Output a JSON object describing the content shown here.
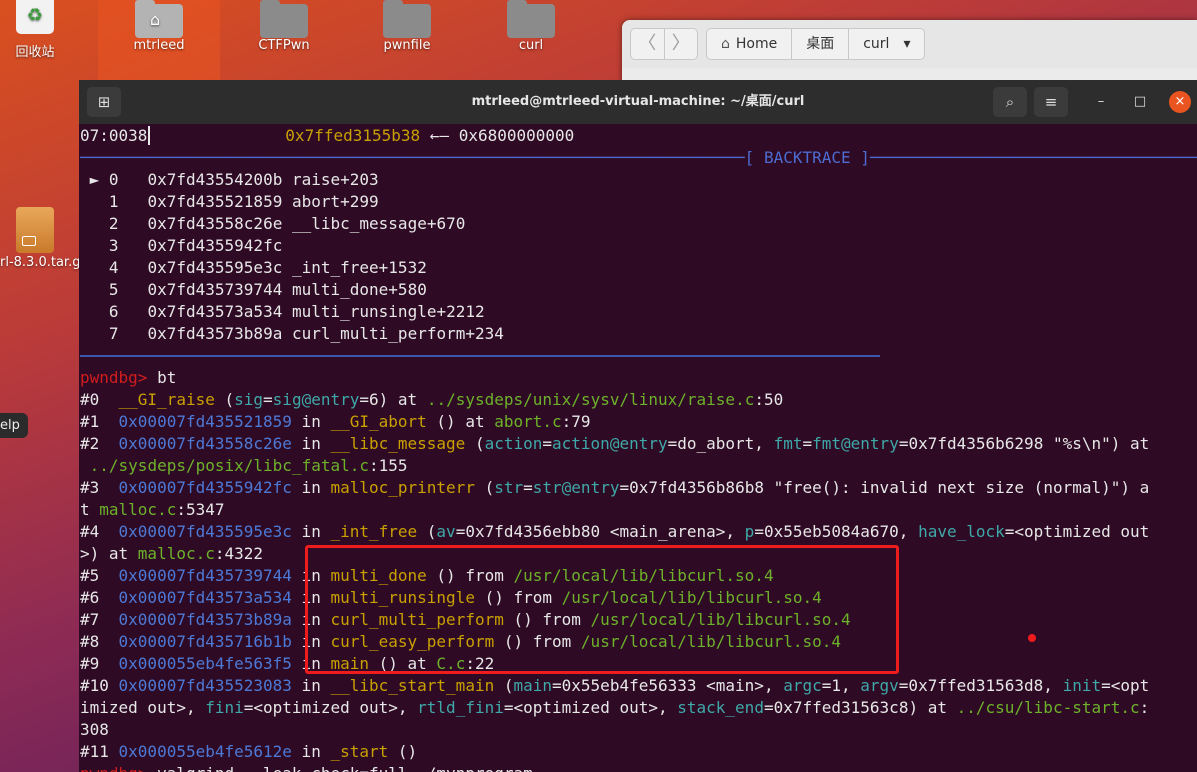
{
  "desktop": {
    "icons": [
      {
        "label": "回收站",
        "name": "trash"
      },
      {
        "label": "mtrleed",
        "name": "home-folder"
      },
      {
        "label": "CTFPwn",
        "name": "ctfpwn-folder"
      },
      {
        "label": "pwnfile",
        "name": "pwnfile-folder"
      },
      {
        "label": "curl",
        "name": "curl-folder"
      }
    ],
    "archive_label": "rl-8.3.0.tar.g",
    "help_tip": "elp"
  },
  "file_manager": {
    "nav_back": "〈",
    "nav_forward": "〉",
    "breadcrumbs": [
      "Home",
      "桌面",
      "curl"
    ],
    "dropdown_icon": "▾"
  },
  "terminal": {
    "title": "mtrleed@mtrleed-virtual-machine: ~/桌面/curl",
    "buttons": {
      "new_tab": "⊞",
      "search": "⌕",
      "menu": "≡",
      "minimize": "–",
      "maximize": "□",
      "close": "×"
    },
    "stack_line": {
      "offset": "07:0038",
      "addr": "0x7ffed3155b38",
      "arrow": " ←— ",
      "value": "0x6800000000"
    },
    "backtrace_header": "[ BACKTRACE ]",
    "backtrace_rule_left": "─────────────────────────────────────────────────────────────────────",
    "backtrace_rule_right": "─────────────────────────────────────────────────────────────",
    "frames": [
      {
        "marker": "►",
        "idx": "0",
        "addr": "0x7fd43554200b",
        "sym": "raise+203"
      },
      {
        "marker": " ",
        "idx": "1",
        "addr": "0x7fd435521859",
        "sym": "abort+299"
      },
      {
        "marker": " ",
        "idx": "2",
        "addr": "0x7fd43558c26e",
        "sym": "__libc_message+670"
      },
      {
        "marker": " ",
        "idx": "3",
        "addr": "0x7fd4355942fc",
        "sym": ""
      },
      {
        "marker": " ",
        "idx": "4",
        "addr": "0x7fd435595e3c",
        "sym": "_int_free+1532"
      },
      {
        "marker": " ",
        "idx": "5",
        "addr": "0x7fd435739744",
        "sym": "multi_done+580"
      },
      {
        "marker": " ",
        "idx": "6",
        "addr": "0x7fd43573a534",
        "sym": "multi_runsingle+2212"
      },
      {
        "marker": " ",
        "idx": "7",
        "addr": "0x7fd43573b89a",
        "sym": "curl_multi_perform+234"
      }
    ],
    "prompt": "pwndbg>",
    "command": " bt",
    "bt_lines": [
      [
        [
          "#0  ",
          "w"
        ],
        [
          "__GI_raise",
          "y"
        ],
        [
          " (",
          "w"
        ],
        [
          "sig",
          "t"
        ],
        [
          "=",
          "w"
        ],
        [
          "sig@entry",
          "t"
        ],
        [
          "=6) at ",
          "w"
        ],
        [
          "../sysdeps/unix/sysv/linux/raise.c",
          "g"
        ],
        [
          ":50",
          "w"
        ]
      ],
      [
        [
          "#1  ",
          "w"
        ],
        [
          "0x00007fd435521859",
          "b"
        ],
        [
          " in ",
          "w"
        ],
        [
          "__GI_abort",
          "y"
        ],
        [
          " () at ",
          "w"
        ],
        [
          "abort.c",
          "g"
        ],
        [
          ":79",
          "w"
        ]
      ],
      [
        [
          "#2  ",
          "w"
        ],
        [
          "0x00007fd43558c26e",
          "b"
        ],
        [
          " in ",
          "w"
        ],
        [
          "__libc_message",
          "y"
        ],
        [
          " (",
          "w"
        ],
        [
          "action",
          "t"
        ],
        [
          "=",
          "w"
        ],
        [
          "action@entry",
          "t"
        ],
        [
          "=do_abort, ",
          "w"
        ],
        [
          "fmt",
          "t"
        ],
        [
          "=",
          "w"
        ],
        [
          "fmt@entry",
          "t"
        ],
        [
          "=0x7fd4356b6298 \"%s\\n\") at",
          "w"
        ]
      ],
      [
        [
          " ",
          "w"
        ],
        [
          "../sysdeps/posix/libc_fatal.c",
          "g"
        ],
        [
          ":155",
          "w"
        ]
      ],
      [
        [
          "#3  ",
          "w"
        ],
        [
          "0x00007fd4355942fc",
          "b"
        ],
        [
          " in ",
          "w"
        ],
        [
          "malloc_printerr",
          "y"
        ],
        [
          " (",
          "w"
        ],
        [
          "str",
          "t"
        ],
        [
          "=",
          "w"
        ],
        [
          "str@entry",
          "t"
        ],
        [
          "=0x7fd4356b86b8 \"free(): invalid next size (normal)\") a",
          "w"
        ]
      ],
      [
        [
          "t ",
          "w"
        ],
        [
          "malloc.c",
          "g"
        ],
        [
          ":5347",
          "w"
        ]
      ],
      [
        [
          "#4  ",
          "w"
        ],
        [
          "0x00007fd435595e3c",
          "b"
        ],
        [
          " in ",
          "w"
        ],
        [
          "_int_free",
          "y"
        ],
        [
          " (",
          "w"
        ],
        [
          "av",
          "t"
        ],
        [
          "=0x7fd4356ebb80 <main_arena>, ",
          "w"
        ],
        [
          "p",
          "t"
        ],
        [
          "=0x55eb5084a670, ",
          "w"
        ],
        [
          "have_lock",
          "t"
        ],
        [
          "=<optimized out",
          "w"
        ]
      ],
      [
        [
          ">) at ",
          "w"
        ],
        [
          "malloc.c",
          "g"
        ],
        [
          ":4322",
          "w"
        ]
      ],
      [
        [
          "#5  ",
          "w"
        ],
        [
          "0x00007fd435739744",
          "b"
        ],
        [
          " in ",
          "w"
        ],
        [
          "multi_done",
          "y"
        ],
        [
          " () from ",
          "w"
        ],
        [
          "/usr/local/lib/libcurl.so.4",
          "g"
        ]
      ],
      [
        [
          "#6  ",
          "w"
        ],
        [
          "0x00007fd43573a534",
          "b"
        ],
        [
          " in ",
          "w"
        ],
        [
          "multi_runsingle",
          "y"
        ],
        [
          " () from ",
          "w"
        ],
        [
          "/usr/local/lib/libcurl.so.4",
          "g"
        ]
      ],
      [
        [
          "#7  ",
          "w"
        ],
        [
          "0x00007fd43573b89a",
          "b"
        ],
        [
          " in ",
          "w"
        ],
        [
          "curl_multi_perform",
          "y"
        ],
        [
          " () from ",
          "w"
        ],
        [
          "/usr/local/lib/libcurl.so.4",
          "g"
        ]
      ],
      [
        [
          "#8  ",
          "w"
        ],
        [
          "0x00007fd435716b1b",
          "b"
        ],
        [
          " in ",
          "w"
        ],
        [
          "curl_easy_perform",
          "y"
        ],
        [
          " () from ",
          "w"
        ],
        [
          "/usr/local/lib/libcurl.so.4",
          "g"
        ]
      ],
      [
        [
          "#9  ",
          "w"
        ],
        [
          "0x000055eb4fe563f5",
          "b"
        ],
        [
          " in ",
          "w"
        ],
        [
          "main",
          "y"
        ],
        [
          " () at ",
          "w"
        ],
        [
          "C.c",
          "g"
        ],
        [
          ":22",
          "w"
        ]
      ],
      [
        [
          "#10 ",
          "w"
        ],
        [
          "0x00007fd435523083",
          "b"
        ],
        [
          " in ",
          "w"
        ],
        [
          "__libc_start_main",
          "y"
        ],
        [
          " (",
          "w"
        ],
        [
          "main",
          "t"
        ],
        [
          "=0x55eb4fe56333 <main>, ",
          "w"
        ],
        [
          "argc",
          "t"
        ],
        [
          "=1, ",
          "w"
        ],
        [
          "argv",
          "t"
        ],
        [
          "=0x7ffed31563d8, ",
          "w"
        ],
        [
          "init",
          "t"
        ],
        [
          "=<opt",
          "w"
        ]
      ],
      [
        [
          "imized out>, ",
          "w"
        ],
        [
          "fini",
          "t"
        ],
        [
          "=<optimized out>, ",
          "w"
        ],
        [
          "rtld_fini",
          "t"
        ],
        [
          "=<optimized out>, ",
          "w"
        ],
        [
          "stack_end",
          "t"
        ],
        [
          "=0x7ffed31563c8) at ",
          "w"
        ],
        [
          "../csu/libc-start.c",
          "g"
        ],
        [
          ":",
          "w"
        ]
      ],
      [
        [
          "308",
          "w"
        ]
      ],
      [
        [
          "#11 ",
          "w"
        ],
        [
          "0x000055eb4fe5612e",
          "b"
        ],
        [
          " in ",
          "w"
        ],
        [
          "_start",
          "y"
        ],
        [
          " ()",
          "w"
        ]
      ],
      [
        [
          "pwndbg>",
          "r"
        ],
        [
          " valgrind --leak-check=full ./mynprogram",
          "w"
        ]
      ]
    ]
  },
  "colors": {
    "prompt": "#d11d1d",
    "highlight_box": "#ee1c1c",
    "terminal_bg": "#2e0a24"
  }
}
